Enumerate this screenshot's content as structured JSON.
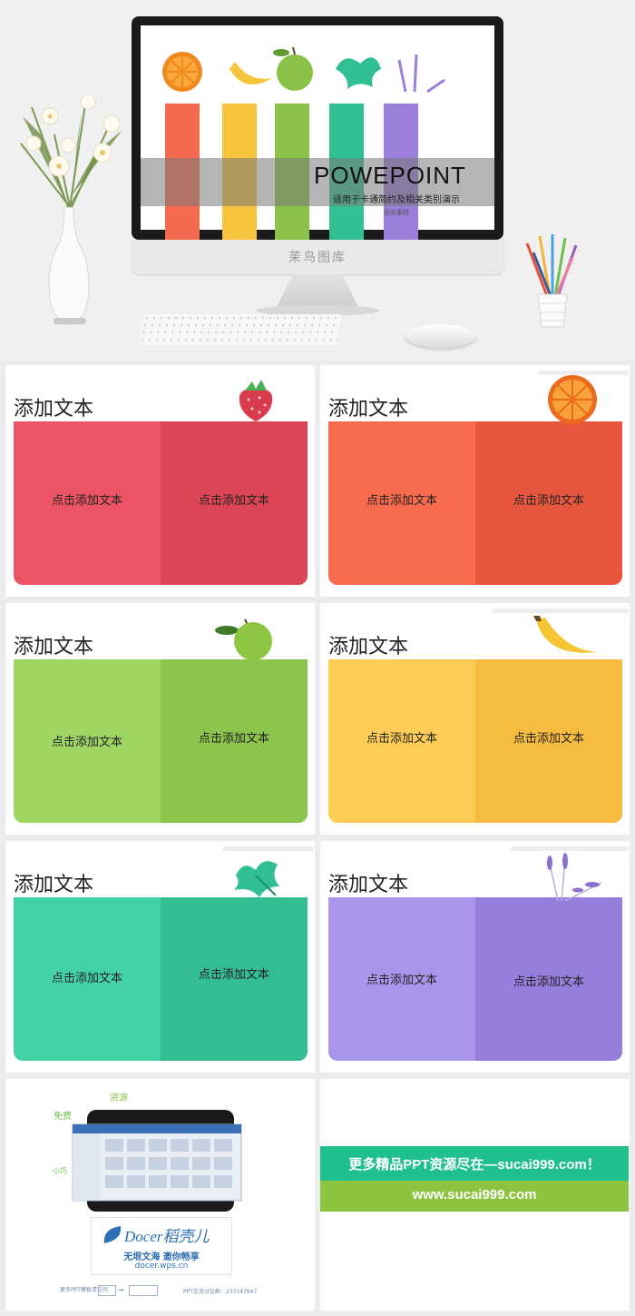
{
  "hero": {
    "slide_title": "POWEPOINT",
    "slide_subtitle": "适用于卡通简约及相关类别演示",
    "slide_tag": "品长素材",
    "monitor_brand": "茉鸟图库",
    "bar_colors": [
      "#f46a4e",
      "#f7c43d",
      "#8ac24a",
      "#31bf94",
      "#9a7ed9"
    ]
  },
  "cards": [
    {
      "title": "添加文本",
      "left_text": "点击添加文本",
      "right_text": "点击添加文本",
      "icon": "strawberry-icon",
      "color_left": "#ec5465",
      "color_right": "#dc4556"
    },
    {
      "title": "添加文本",
      "left_text": "点击添加文本",
      "right_text": "点击添加文本",
      "icon": "orange-icon",
      "color_left": "#f96b4e",
      "color_right": "#e7563d"
    },
    {
      "title": "添加文本",
      "left_text": "点击添加文本",
      "right_text": "点击添加文本",
      "icon": "lime-icon",
      "color_left": "#9fd563",
      "color_right": "#8cc54c"
    },
    {
      "title": "添加文本",
      "left_text": "点击添加文本",
      "right_text": "点击添加文本",
      "icon": "banana-icon",
      "color_left": "#fdcc55",
      "color_right": "#f6bc3f"
    },
    {
      "title": "添加文本",
      "left_text": "点击添加文本",
      "right_text": "点击添加文本",
      "icon": "mint-icon",
      "color_left": "#45d1a7",
      "color_right": "#34bd93"
    },
    {
      "title": "添加文本",
      "left_text": "点击添加文本",
      "right_text": "点击添加文本",
      "icon": "lavender-icon",
      "color_left": "#a996ec",
      "color_right": "#967edc"
    }
  ],
  "docer": {
    "logo": "Docer稻壳儿",
    "slogan": "无垠文海 邀你畅享",
    "url": "docer.wps.cn",
    "tags": [
      "资源",
      "免费",
      "小巧"
    ],
    "footer_left": "更多PPT模板请访问",
    "footer_right": "PPT交流讨论群：233147947"
  },
  "promo": {
    "line1": "更多精品PPT资源尽在—sucai999.com！",
    "line2": "www.sucai999.com"
  }
}
